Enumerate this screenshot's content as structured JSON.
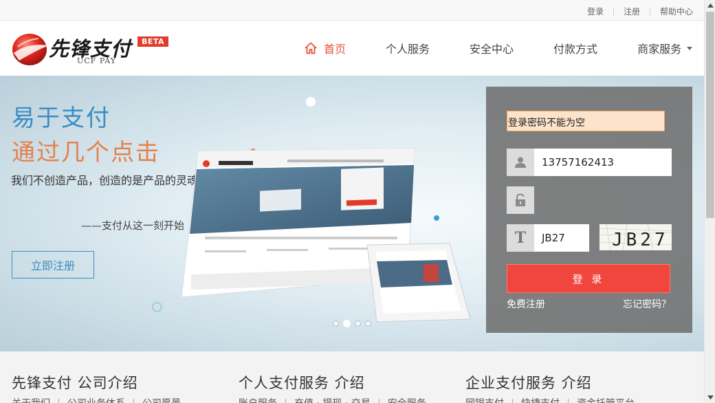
{
  "topbar": {
    "links": [
      "登录",
      "注册",
      "帮助中心"
    ]
  },
  "logo": {
    "name": "先锋支付",
    "sub": "UCF PAY",
    "badge": "BETA"
  },
  "nav": {
    "home": "首页",
    "personal": "个人服务",
    "security": "安全中心",
    "payment": "付款方式",
    "merchant": "商家服务",
    "active_color": "#e8503a"
  },
  "banner": {
    "slogan1": "易于支付",
    "slogan2": "通过几个点击",
    "description": "我们不创造产品，创造的是产品的灵魂。",
    "motto": "——支付从这一刻开始",
    "register_button": "立即注册",
    "carousel_count": 4,
    "carousel_active": 1
  },
  "login": {
    "error": "登录密码不能为空",
    "username_value": "13757162413",
    "password_value": "",
    "captcha_value": "JB27",
    "captcha_image_text": "JB27",
    "submit": "登 录",
    "free_register": "免费注册",
    "forgot": "忘记密码？",
    "icons": {
      "user": "user-icon",
      "lock": "lock-icon",
      "captcha": "text-t-icon"
    }
  },
  "intro": {
    "columns": [
      {
        "title": "先锋支付  公司介绍",
        "links": [
          "关于我们",
          "公司业务体系",
          "公司愿景"
        ]
      },
      {
        "title": "个人支付服务  介绍",
        "links": [
          "账户服务",
          "充值 · 提现 · 交易",
          "安全服务"
        ]
      },
      {
        "title": "企业支付服务  介绍",
        "links": [
          "网银支付",
          "快捷支付",
          "资金托管平台"
        ]
      }
    ]
  },
  "colors": {
    "brand_red": "#e23b2c",
    "blue": "#3a8ec2",
    "orange": "#e6804a",
    "login_button": "#f0463d"
  }
}
